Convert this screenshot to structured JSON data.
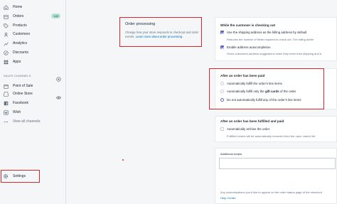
{
  "sidebar": {
    "items": [
      {
        "label": "Home",
        "icon": "home-icon"
      },
      {
        "label": "Orders",
        "icon": "orders-icon",
        "badge": "188"
      },
      {
        "label": "Products",
        "icon": "tag-icon"
      },
      {
        "label": "Customers",
        "icon": "customers-icon"
      },
      {
        "label": "Analytics",
        "icon": "analytics-icon"
      },
      {
        "label": "Discounts",
        "icon": "discount-icon"
      },
      {
        "label": "Apps",
        "icon": "apps-icon"
      }
    ],
    "sales_channels_title": "SALES CHANNELS",
    "channels": [
      {
        "label": "Point of Sale",
        "icon": "pos-icon"
      },
      {
        "label": "Online Store",
        "icon": "store-icon"
      },
      {
        "label": "Facebook",
        "icon": "facebook-icon"
      },
      {
        "label": "Wish",
        "icon": "wish-icon"
      },
      {
        "label": "View all channels",
        "icon": "more-icon"
      }
    ],
    "settings_label": "Settings"
  },
  "order_processing": {
    "title": "Order processing",
    "description": "Change how your store responds to checkout and order events.",
    "link": "Learn more about order processing."
  },
  "checkout": {
    "title": "While the customer is checking out",
    "options": [
      {
        "label": "Use the shipping address as the billing address by default",
        "checked": true,
        "help": "Reduces the number of fields required to check out. The billing addre"
      },
      {
        "label": "Enable address autocompletion",
        "checked": true,
        "help": "Gives customers address suggestions when they enter their shipping and b"
      }
    ]
  },
  "after_paid": {
    "title": "After an order has been paid",
    "options": [
      {
        "label": "Automatically fulfill the order's line items",
        "selected": false
      },
      {
        "label_before": "Automatically fulfill only the ",
        "label_bold": "gift cards",
        "label_after": " of the order",
        "selected": false
      },
      {
        "label": "Do not automatically fulfill any of the order's line items",
        "selected": true
      }
    ]
  },
  "after_fulfilled": {
    "title": "After an order has been fulfilled and paid",
    "option": {
      "label": "Automatically archive the order",
      "checked": false
    },
    "help": "Fulfilled orders will be automatically removed from the open orders list."
  },
  "additional_scripts": {
    "label": "Additional scripts",
    "help": "Any customizations you'd like to appear on the order status page of the checkout",
    "link": "Help Center."
  },
  "colors": {
    "highlight": "#d9272e",
    "accent": "#5c6ac4",
    "link": "#006fbb"
  }
}
